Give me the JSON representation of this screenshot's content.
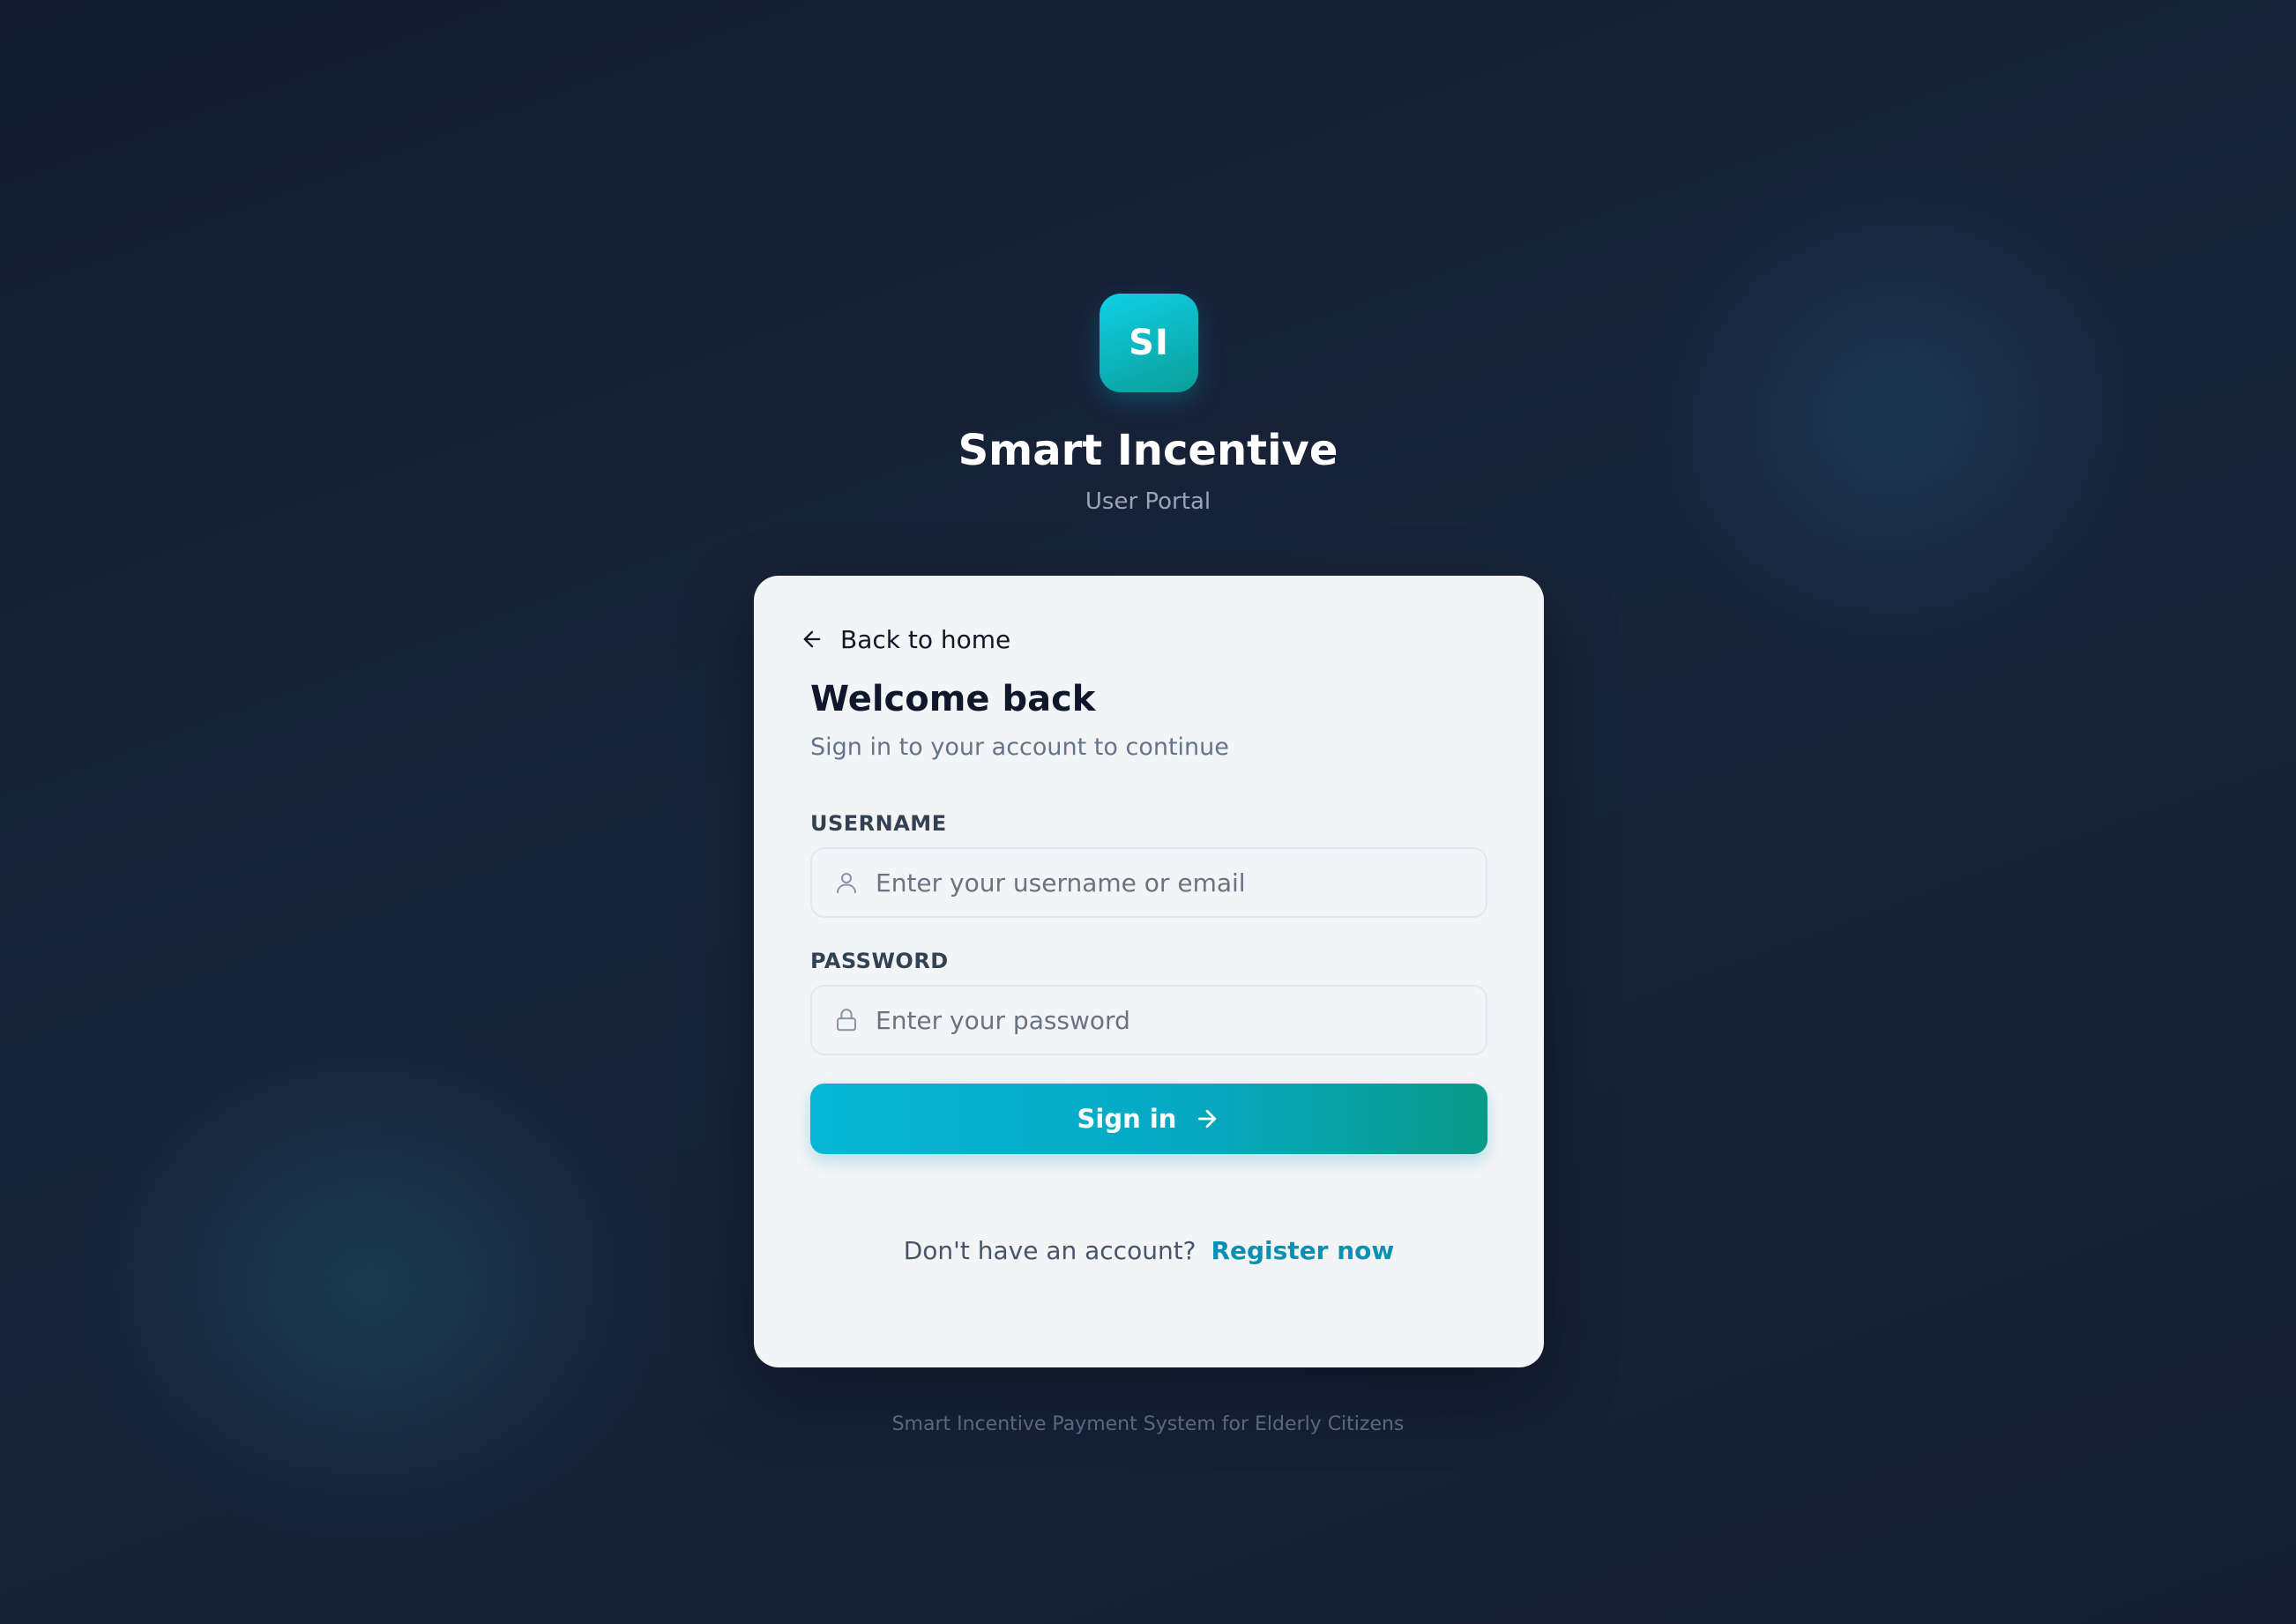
{
  "brand": {
    "logo_initials": "SI",
    "app_name": "Smart Incentive",
    "portal_name": "User Portal",
    "accent_start": "#06b6d4",
    "accent_end": "#0a9a88"
  },
  "card": {
    "back_link_label": "Back to home",
    "back_icon": "arrow-left-icon",
    "title": "Welcome back",
    "subtitle": "Sign in to your account to continue",
    "username": {
      "label": "USERNAME",
      "placeholder": "Enter your username or email",
      "value": "",
      "icon": "user-icon"
    },
    "password": {
      "label": "PASSWORD",
      "placeholder": "Enter your password",
      "value": "",
      "icon": "lock-icon"
    },
    "signin_button_label": "Sign in",
    "signin_icon": "arrow-right-icon",
    "register_prompt": "Don't have an account?",
    "register_link_label": "Register now"
  },
  "footer": {
    "text": "Smart Incentive Payment System for Elderly Citizens"
  }
}
